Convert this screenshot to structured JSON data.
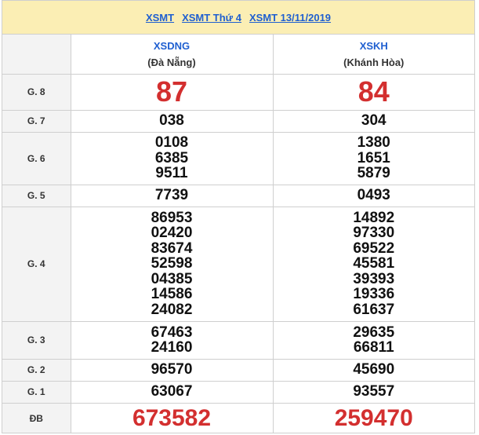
{
  "header": {
    "links": [
      "XSMT",
      "XSMT Thứ 4",
      "XSMT 13/11/2019"
    ]
  },
  "provinces": [
    {
      "code": "XSDNG",
      "name": "(Đà Nẵng)"
    },
    {
      "code": "XSKH",
      "name": "(Khánh Hòa)"
    }
  ],
  "prizes": [
    {
      "label": "G. 8",
      "col1": [
        "87"
      ],
      "col2": [
        "84"
      ]
    },
    {
      "label": "G. 7",
      "col1": [
        "038"
      ],
      "col2": [
        "304"
      ]
    },
    {
      "label": "G. 6",
      "col1": [
        "0108",
        "6385",
        "9511"
      ],
      "col2": [
        "1380",
        "1651",
        "5879"
      ]
    },
    {
      "label": "G. 5",
      "col1": [
        "7739"
      ],
      "col2": [
        "0493"
      ]
    },
    {
      "label": "G. 4",
      "col1": [
        "86953",
        "02420",
        "83674",
        "52598",
        "04385",
        "14586",
        "24082"
      ],
      "col2": [
        "14892",
        "97330",
        "69522",
        "45581",
        "39393",
        "19336",
        "61637"
      ]
    },
    {
      "label": "G. 3",
      "col1": [
        "67463",
        "24160"
      ],
      "col2": [
        "29635",
        "66811"
      ]
    },
    {
      "label": "G. 2",
      "col1": [
        "96570"
      ],
      "col2": [
        "45690"
      ]
    },
    {
      "label": "G. 1",
      "col1": [
        "63067"
      ],
      "col2": [
        "93557"
      ]
    },
    {
      "label": "ĐB",
      "col1": [
        "673582"
      ],
      "col2": [
        "259470"
      ]
    }
  ],
  "colors": {
    "accent_link": "#1f5fd0",
    "highlight_red": "#d32f2f",
    "header_bg": "#fbeeb4"
  }
}
